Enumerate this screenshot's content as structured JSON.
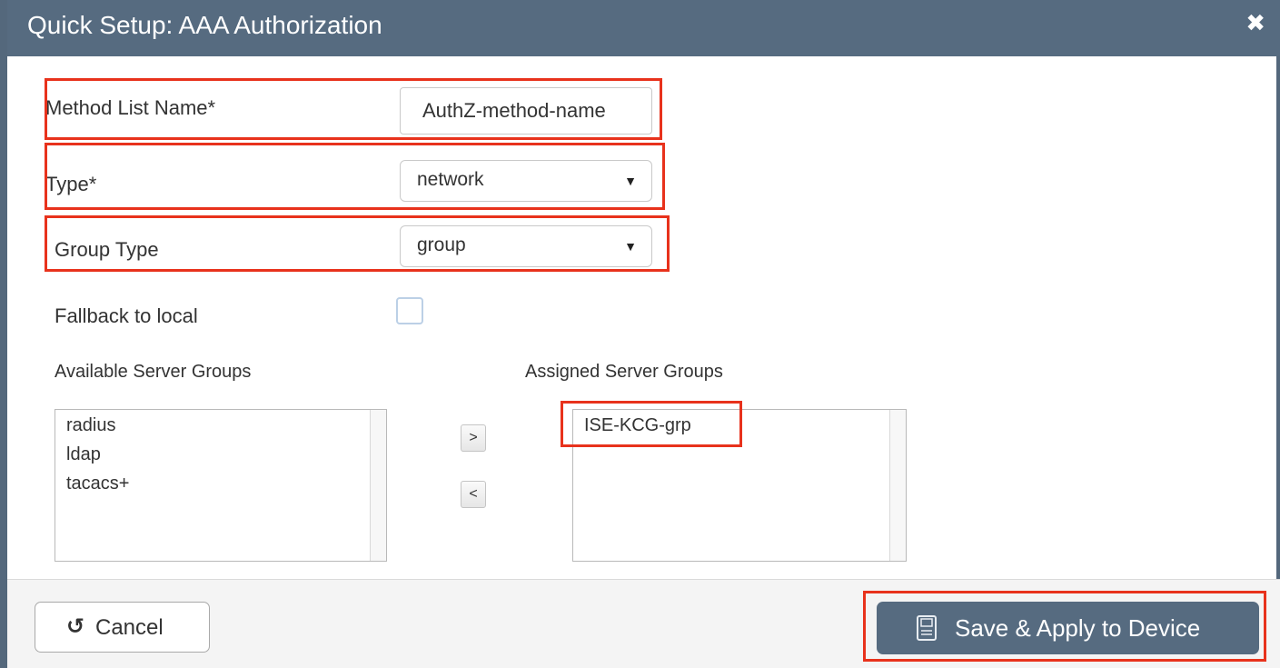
{
  "dialog": {
    "title": "Quick Setup: AAA Authorization",
    "close_icon": "close-icon"
  },
  "form": {
    "method_list_name": {
      "label": "Method List Name*",
      "value": "AuthZ-method-name"
    },
    "type": {
      "label": "Type*",
      "value": "network"
    },
    "group_type": {
      "label": "Group Type",
      "value": "group"
    },
    "fallback": {
      "label": "Fallback to local",
      "checked": false
    }
  },
  "server_groups": {
    "available_label": "Available Server Groups",
    "assigned_label": "Assigned Server Groups",
    "available": [
      "radius",
      "ldap",
      "tacacs+"
    ],
    "assigned": [
      "ISE-KCG-grp"
    ],
    "move_right_label": ">",
    "move_left_label": "<"
  },
  "footer": {
    "cancel_label": "Cancel",
    "save_label": "Save & Apply to Device"
  },
  "colors": {
    "titlebar": "#566b80",
    "highlight": "#e8321c",
    "save_button": "#566b80"
  }
}
